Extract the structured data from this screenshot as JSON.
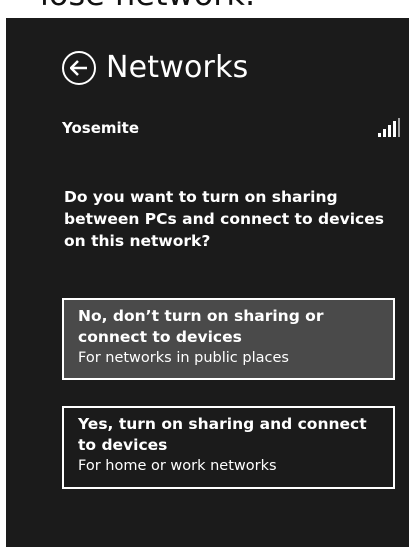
{
  "caption_cropped": "lose network.",
  "panel": {
    "title": "Networks",
    "network": {
      "name": "Yosemite",
      "signal_icon": "signal-strength-icon"
    },
    "question": "Do you want to turn on sharing between PCs and connect to devices on this network?",
    "options": [
      {
        "title": "No, don’t turn on sharing or connect to devices",
        "subtitle": "For networks in public places"
      },
      {
        "title": "Yes, turn on sharing and connect to devices",
        "subtitle": "For home or work networks"
      }
    ]
  },
  "colors": {
    "panel_bg": "#1b1b1b",
    "selected_option_bg": "#4a4a4a",
    "text": "#ffffff",
    "page_bg": "#ffffff"
  }
}
